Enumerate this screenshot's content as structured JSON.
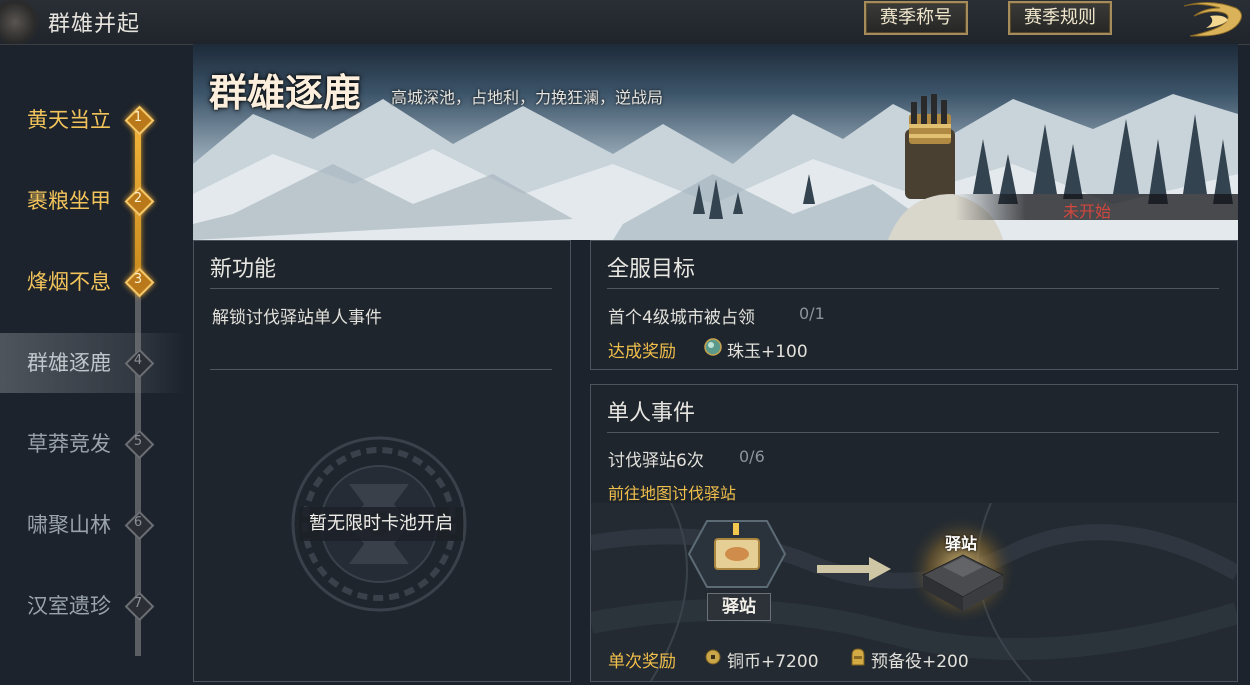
{
  "header": {
    "game_title": "群雄并起",
    "season_title_button": "赛季称号",
    "season_rules_button": "赛季规则"
  },
  "sidebar": {
    "chapters": [
      {
        "label": "黄天当立",
        "num": "1",
        "state": "done"
      },
      {
        "label": "裹粮坐甲",
        "num": "2",
        "state": "done"
      },
      {
        "label": "烽烟不息",
        "num": "3",
        "state": "done"
      },
      {
        "label": "群雄逐鹿",
        "num": "4",
        "state": "current"
      },
      {
        "label": "草莽竞发",
        "num": "5",
        "state": "locked"
      },
      {
        "label": "啸聚山林",
        "num": "6",
        "state": "locked"
      },
      {
        "label": "汉室遗珍",
        "num": "7",
        "state": "locked"
      }
    ]
  },
  "banner": {
    "title": "群雄逐鹿",
    "subtitle": "高城深池，占地利，力挽狂澜，逆战局",
    "status": "未开始"
  },
  "new_features": {
    "title": "新功能",
    "item": "解锁讨伐驿站单人事件",
    "empty_pool": "暂无限时卡池开启"
  },
  "server_goal": {
    "title": "全服目标",
    "task": "首个4级城市被占领",
    "progress": "0/1",
    "reward_label": "达成奖励",
    "reward": "珠玉+100"
  },
  "single_event": {
    "title": "单人事件",
    "task": "讨伐驿站6次",
    "progress": "0/6",
    "link": "前往地图讨伐驿站",
    "station_label": "驿站",
    "station_label_2": "驿站",
    "reward_label": "单次奖励",
    "reward_1": "铜币+7200",
    "reward_2": "预备役+200"
  },
  "colors": {
    "gold": "#f0be4b",
    "status_red": "#d2473e",
    "panel_bg": "#1e252e"
  }
}
